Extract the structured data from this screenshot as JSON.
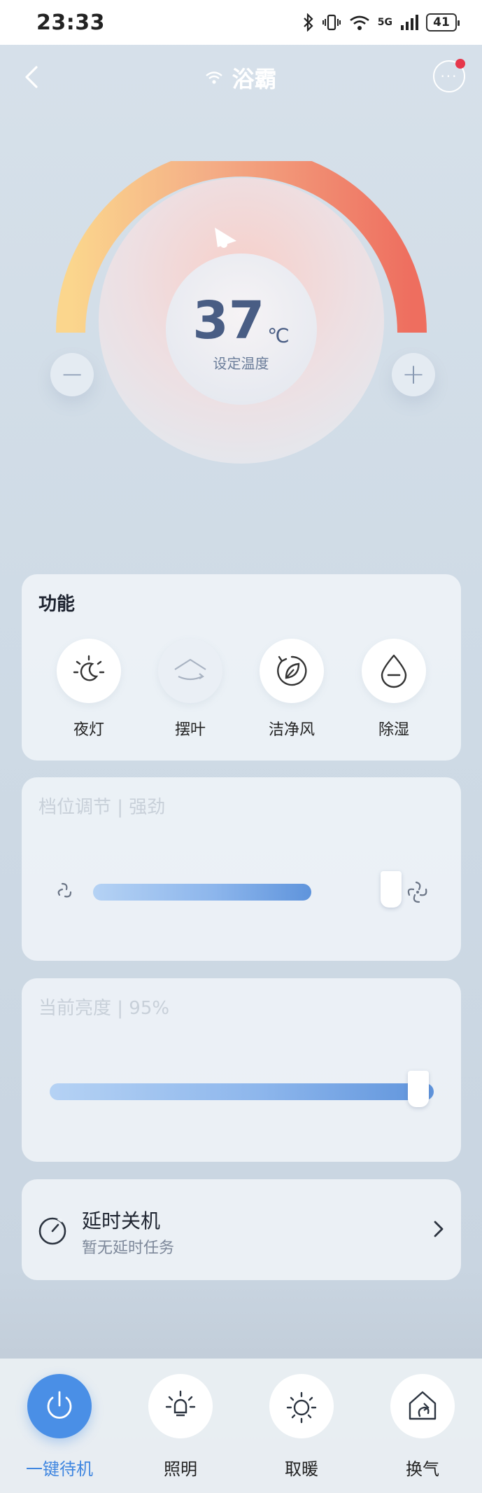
{
  "status_bar": {
    "time": "23:33",
    "network": "5G",
    "battery": "41"
  },
  "header": {
    "title": "浴霸"
  },
  "dial": {
    "temperature": "37",
    "unit": "℃",
    "label": "设定温度"
  },
  "functions": {
    "title": "功能",
    "items": [
      {
        "label": "夜灯",
        "icon": "night-light-icon"
      },
      {
        "label": "摆叶",
        "icon": "swing-icon"
      },
      {
        "label": "洁净风",
        "icon": "clean-air-icon"
      },
      {
        "label": "除湿",
        "icon": "dehumidify-icon"
      }
    ]
  },
  "fan_speed": {
    "title": "档位调节 | 强劲",
    "level": 1.0
  },
  "brightness": {
    "title": "当前亮度 | 95%",
    "level": 0.95
  },
  "timer": {
    "title": "延时关机",
    "subtitle": "暂无延时任务"
  },
  "tabs": [
    {
      "label": "一键待机",
      "icon": "power-icon",
      "active": true
    },
    {
      "label": "照明",
      "icon": "bulb-icon",
      "active": false
    },
    {
      "label": "取暖",
      "icon": "sun-icon",
      "active": false
    },
    {
      "label": "换气",
      "icon": "ventilation-icon",
      "active": false
    }
  ],
  "colors": {
    "accent": "#4a8fe6",
    "temperature_text": "#495d84",
    "notification_dot": "#e6374b"
  }
}
